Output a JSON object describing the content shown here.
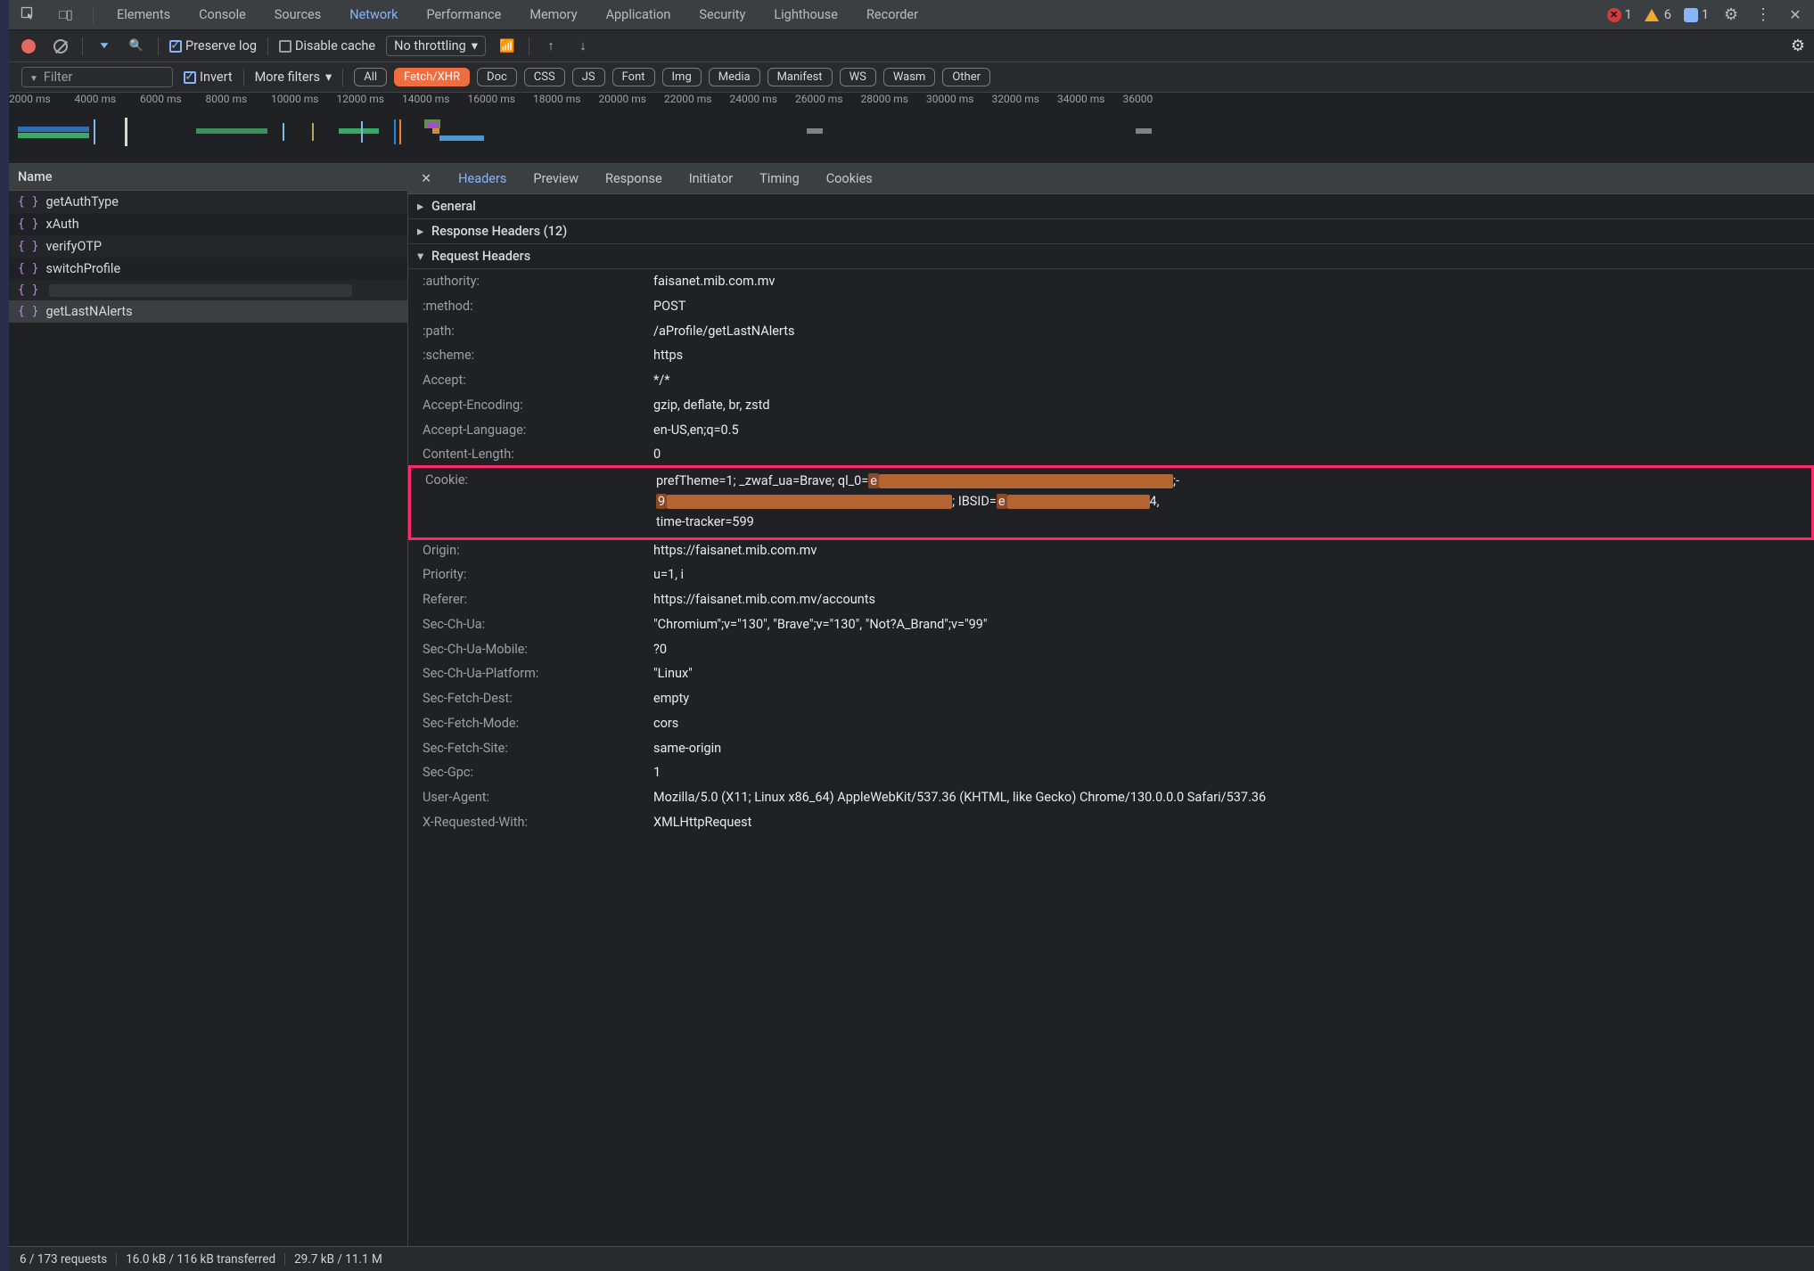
{
  "topTabs": {
    "items": [
      "Elements",
      "Console",
      "Sources",
      "Network",
      "Performance",
      "Memory",
      "Application",
      "Security",
      "Lighthouse",
      "Recorder"
    ],
    "active": "Network",
    "errors": "1",
    "warnings": "6",
    "info": "1"
  },
  "toolbar": {
    "preserve_log": "Preserve log",
    "disable_cache": "Disable cache",
    "throttling": "No throttling"
  },
  "filterbar": {
    "placeholder": "Filter",
    "invert": "Invert",
    "more_filters": "More filters",
    "chips": [
      "All",
      "Fetch/XHR",
      "Doc",
      "CSS",
      "JS",
      "Font",
      "Img",
      "Media",
      "Manifest",
      "WS",
      "Wasm",
      "Other"
    ],
    "active_chip": "Fetch/XHR"
  },
  "timeline": {
    "labels": [
      "2000 ms",
      "4000 ms",
      "6000 ms",
      "8000 ms",
      "10000 ms",
      "12000 ms",
      "14000 ms",
      "16000 ms",
      "18000 ms",
      "20000 ms",
      "22000 ms",
      "24000 ms",
      "26000 ms",
      "28000 ms",
      "30000 ms",
      "32000 ms",
      "34000 ms",
      "36000"
    ]
  },
  "leftPane": {
    "head": "Name",
    "rows": [
      {
        "name": "getAuthType",
        "redacted": false
      },
      {
        "name": "xAuth",
        "redacted": false
      },
      {
        "name": "verifyOTP",
        "redacted": false
      },
      {
        "name": "switchProfile",
        "redacted": false
      },
      {
        "name": "",
        "redacted": true
      },
      {
        "name": "getLastNAlerts",
        "redacted": false,
        "selected": true
      }
    ]
  },
  "detail": {
    "tabs": [
      "Headers",
      "Preview",
      "Response",
      "Initiator",
      "Timing",
      "Cookies"
    ],
    "active": "Headers",
    "general_label": "General",
    "response_headers_label": "Response Headers (12)",
    "request_headers_label": "Request Headers",
    "headers": [
      {
        "k": ":authority:",
        "v": "faisanet.mib.com.mv"
      },
      {
        "k": ":method:",
        "v": "POST"
      },
      {
        "k": ":path:",
        "v": "/aProfile/getLastNAlerts"
      },
      {
        "k": ":scheme:",
        "v": "https"
      },
      {
        "k": "Accept:",
        "v": "*/*"
      },
      {
        "k": "Accept-Encoding:",
        "v": "gzip, deflate, br, zstd"
      },
      {
        "k": "Accept-Language:",
        "v": "en-US,en;q=0.5"
      },
      {
        "k": "Content-Length:",
        "v": "0"
      }
    ],
    "cookie": {
      "k": "Cookie:",
      "prefix": "prefTheme=1; _zwaf_ua=Brave; ql_0=",
      "mid": "; IBSID=",
      "suffix": "time-tracker=599"
    },
    "headers2": [
      {
        "k": "Origin:",
        "v": "https://faisanet.mib.com.mv"
      },
      {
        "k": "Priority:",
        "v": "u=1, i"
      },
      {
        "k": "Referer:",
        "v": "https://faisanet.mib.com.mv/accounts"
      },
      {
        "k": "Sec-Ch-Ua:",
        "v": "\"Chromium\";v=\"130\", \"Brave\";v=\"130\", \"Not?A_Brand\";v=\"99\""
      },
      {
        "k": "Sec-Ch-Ua-Mobile:",
        "v": "?0"
      },
      {
        "k": "Sec-Ch-Ua-Platform:",
        "v": "\"Linux\""
      },
      {
        "k": "Sec-Fetch-Dest:",
        "v": "empty"
      },
      {
        "k": "Sec-Fetch-Mode:",
        "v": "cors"
      },
      {
        "k": "Sec-Fetch-Site:",
        "v": "same-origin"
      },
      {
        "k": "Sec-Gpc:",
        "v": "1"
      },
      {
        "k": "User-Agent:",
        "v": "Mozilla/5.0 (X11; Linux x86_64) AppleWebKit/537.36 (KHTML, like Gecko) Chrome/130.0.0.0 Safari/537.36"
      },
      {
        "k": "X-Requested-With:",
        "v": "XMLHttpRequest"
      }
    ]
  },
  "status": {
    "requests": "6 / 173 requests",
    "transferred": "16.0 kB / 116 kB transferred",
    "resources": "29.7 kB / 11.1 M"
  }
}
